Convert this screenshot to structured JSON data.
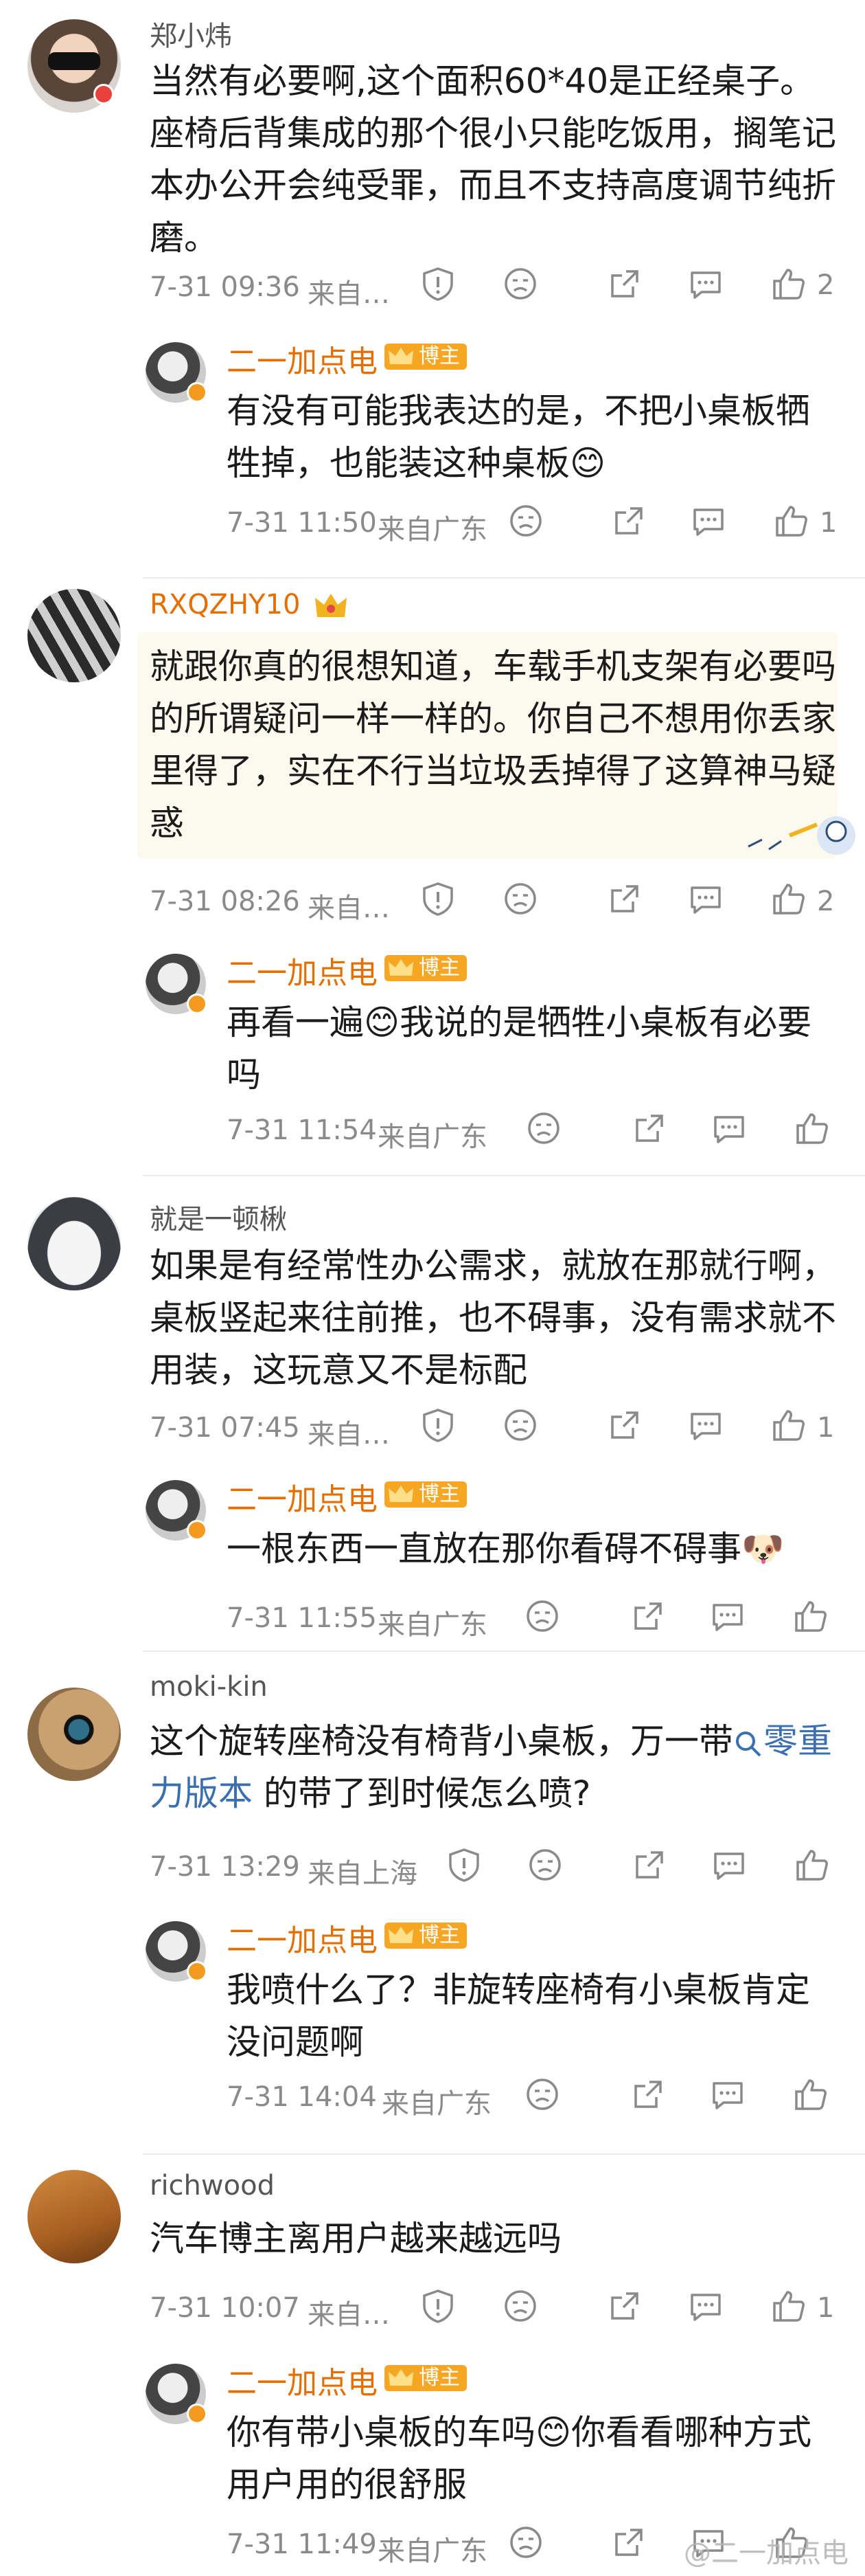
{
  "colors": {
    "accent": "#e46f00",
    "link": "#3a6fb0",
    "muted": "#8a8a8a",
    "badge": "#f6a623"
  },
  "comments": [
    {
      "user": "郑小炜",
      "text": "当然有必要啊,这个面积60*40是正经桌子。座椅后背集成的那个很小只能吃饭用，搁笔记本办公开会纯受罪，而且不支持高度调节纯折磨。",
      "date": "7-31 09:36",
      "location": "来自…",
      "likes": "2",
      "reply": {
        "user": "二一加点电",
        "badge": "博主",
        "text": "有没有可能我表达的是，不把小桌板牺牲掉，也能装这种桌板😊",
        "date": "7-31 11:50",
        "location": "来自广东",
        "likes": "1"
      }
    },
    {
      "user": "RXQZHY10",
      "text": "就跟你真的很想知道，车载手机支架有必要吗的所谓疑问一样一样的。你自己不想用你丢家里得了，实在不行当垃圾丢掉得了这算神马疑惑",
      "date": "7-31 08:26",
      "location": "来自…",
      "likes": "2",
      "reply": {
        "user": "二一加点电",
        "badge": "博主",
        "text": "再看一遍😊我说的是牺牲小桌板有必要吗",
        "date": "7-31 11:54",
        "location": "来自广东",
        "likes": ""
      }
    },
    {
      "user": "就是一顿楸",
      "text": "如果是有经常性办公需求，就放在那就行啊，桌板竖起来往前推，也不碍事，没有需求就不用装，这玩意又不是标配",
      "date": "7-31 07:45",
      "location": "来自…",
      "likes": "1",
      "reply": {
        "user": "二一加点电",
        "badge": "博主",
        "text": "一根东西一直放在那你看碍不碍事🐶",
        "date": "7-31 11:55",
        "location": "来自广东",
        "likes": ""
      }
    },
    {
      "user": "moki-kin",
      "text_before": "这个旋转座椅没有椅背小桌板，万一带",
      "text_link": "零重力版本",
      "text_after": " 的带了到时候怎么喷?",
      "date": "7-31 13:29",
      "location": "来自上海",
      "likes": "",
      "reply": {
        "user": "二一加点电",
        "badge": "博主",
        "text": "我喷什么了？非旋转座椅有小桌板肯定没问题啊",
        "date": "7-31 14:04",
        "location": "来自广东",
        "likes": ""
      }
    },
    {
      "user": "richwood",
      "text": "汽车博主离用户越来越远吗",
      "date": "7-31 10:07",
      "location": "来自…",
      "likes": "1",
      "reply": {
        "user": "二一加点电",
        "badge": "博主",
        "text": "你有带小桌板的车吗😊你看看哪种方式用户用的很舒服",
        "date": "7-31 11:49",
        "location": "来自广东",
        "likes": ""
      }
    }
  ],
  "watermark": "@二一加点电"
}
